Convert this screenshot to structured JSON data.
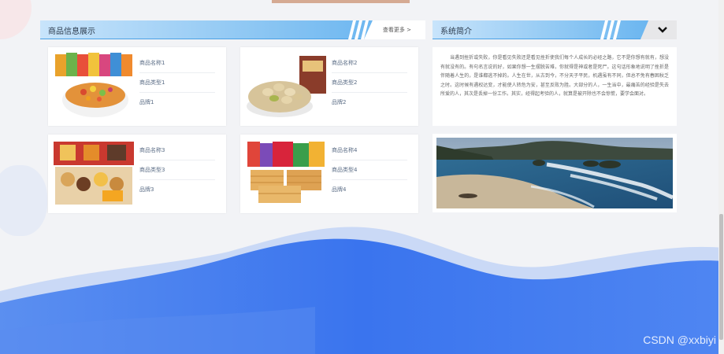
{
  "product_panel": {
    "title": "商品信息展示",
    "more_label": "查看更多 >"
  },
  "intro_panel": {
    "title": "系统简介",
    "text": "当遇到挫折或失败，你是看见失败还是看见挫折使我们每个人成长的必经之路，它不是你想有就有，想没有就没有的。有句名言说的好，如果你想一生摆脱苦难，你就得是神或者是死尸。这句话形象地说明了挫折是伴随着人生的，是谁都逃不掉的。人生在世，从古到今，不分天子平民，机遇虽有不同，但总不免有春困秋乏之时。这时候有遇权达变，才能使人转危为安，甚至反败为胜。大部分的人，一生当中，最痛苦的经验是失去所爱的人，其次是丢掉一份工作。其实，经得起考验的人，就算是被开除也不会惊慌，要学会面对。"
  },
  "products": [
    {
      "name": "商品名称1",
      "type": "商品类型1",
      "brand": "品牌1",
      "image": "candy-bowl-image"
    },
    {
      "name": "商品名称2",
      "type": "商品类型2",
      "brand": "品牌2",
      "image": "pistachio-image"
    },
    {
      "name": "商品名称3",
      "type": "商品类型3",
      "brand": "品牌3",
      "image": "snack-box-image"
    },
    {
      "name": "商品名称4",
      "type": "商品类型4",
      "brand": "品牌4",
      "image": "rice-crackers-image"
    }
  ],
  "icons": {
    "collapse": "chevron-down-icon"
  },
  "colors": {
    "bar_light": "#c8e4fb",
    "bar_dark": "#5fb0ef",
    "wave": "#3d78ee",
    "background": "#f2f3f6"
  },
  "watermark": "CSDN @xxbiyi"
}
